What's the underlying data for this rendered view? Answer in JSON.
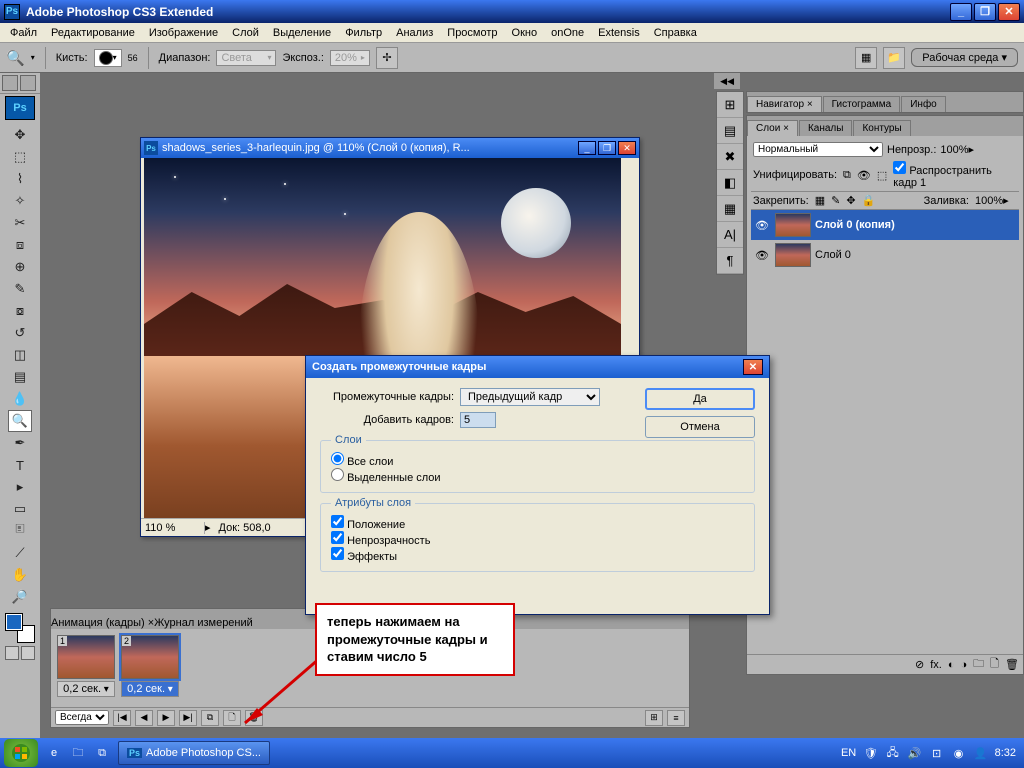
{
  "app": {
    "title": "Adobe Photoshop CS3 Extended"
  },
  "menu": [
    "Файл",
    "Редактирование",
    "Изображение",
    "Слой",
    "Выделение",
    "Фильтр",
    "Анализ",
    "Просмотр",
    "Окно",
    "onOne",
    "Extensis",
    "Справка"
  ],
  "options": {
    "brush_label": "Кисть:",
    "brush_size": "56",
    "range_label": "Диапазон:",
    "range_value": "Света",
    "exposure_label": "Экспоз.:",
    "exposure_value": "20%",
    "workspace": "Рабочая среда"
  },
  "document": {
    "title": "shadows_series_3-harlequin.jpg @ 110% (Слой 0 (копия), R...",
    "zoom": "110 %",
    "doc_size": "Док: 508,0"
  },
  "dialog": {
    "title": "Создать промежуточные кадры",
    "tween_label": "Промежуточные кадры:",
    "tween_value": "Предыдущий кадр",
    "add_label": "Добавить кадров:",
    "add_value": "5",
    "layers_legend": "Слои",
    "all_layers": "Все слои",
    "selected_layers": "Выделенные слои",
    "attrs_legend": "Атрибуты слоя",
    "attr_position": "Положение",
    "attr_opacity": "Непрозрачность",
    "attr_effects": "Эффекты",
    "ok": "Да",
    "cancel": "Отмена"
  },
  "callout": "теперь нажимаем на промежуточные кадры и ставим число 5",
  "panels": {
    "navigator_tabs": [
      "Навигатор ×",
      "Гистограмма",
      "Инфо"
    ],
    "layers_tabs": [
      "Слои ×",
      "Каналы",
      "Контуры"
    ],
    "blend_mode": "Нормальный",
    "opacity_label": "Непрозр.:",
    "opacity_value": "100%",
    "unify_label": "Унифицировать:",
    "propagate": "Распространить кадр 1",
    "lock_label": "Закрепить:",
    "fill_label": "Заливка:",
    "fill_value": "100%",
    "layer1": "Слой 0 (копия)",
    "layer2": "Слой 0"
  },
  "animation": {
    "tabs": [
      "Анимация (кадры) ×",
      "Журнал измерений"
    ],
    "frame1_delay": "0,2 сек.",
    "frame2_delay": "0,2 сек.",
    "loop": "Всегда"
  },
  "taskbar": {
    "app_task": "Adobe Photoshop CS...",
    "lang": "EN",
    "time": "8:32"
  }
}
